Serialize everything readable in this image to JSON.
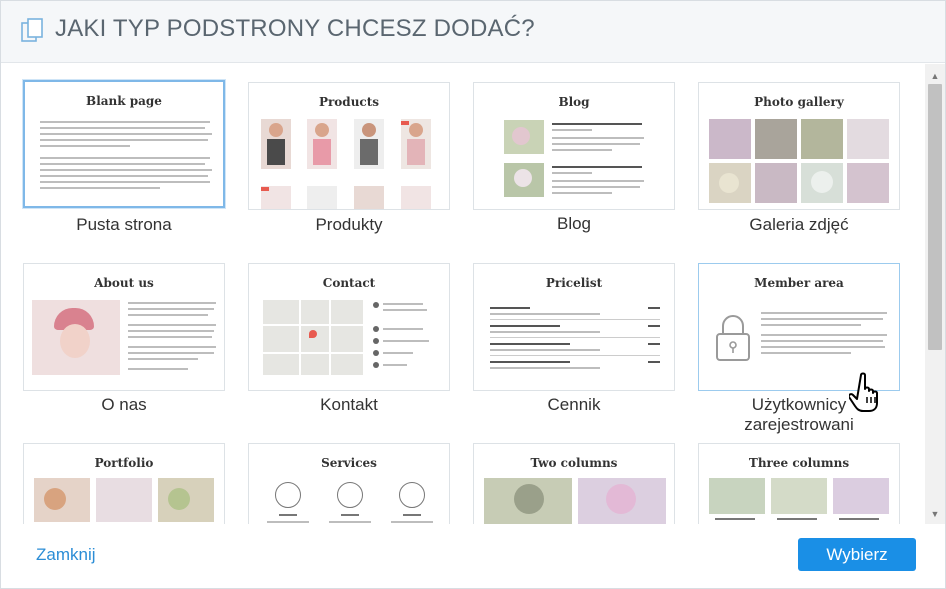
{
  "header": {
    "title": "JAKI TYP PODSTRONY CHCESZ DODAĆ?"
  },
  "cards": [
    {
      "preview_title": "Blank page",
      "label": "Pusta strona"
    },
    {
      "preview_title": "Products",
      "label": "Produkty"
    },
    {
      "preview_title": "Blog",
      "label": "Blog"
    },
    {
      "preview_title": "Photo gallery",
      "label": "Galeria zdjęć"
    },
    {
      "preview_title": "About us",
      "label": "O nas"
    },
    {
      "preview_title": "Contact",
      "label": "Kontakt"
    },
    {
      "preview_title": "Pricelist",
      "label": "Cennik"
    },
    {
      "preview_title": "Member area",
      "label_line1": "Użytkownicy",
      "label_line2": "zarejestrowani"
    },
    {
      "preview_title": "Portfolio"
    },
    {
      "preview_title": "Services"
    },
    {
      "preview_title": "Two columns"
    },
    {
      "preview_title": "Three columns"
    }
  ],
  "footer": {
    "close_label": "Zamknij",
    "select_label": "Wybierz"
  },
  "colors": {
    "accent": "#1a8fe6",
    "link": "#2b8dd6",
    "selected_border": "#7fb8e8"
  },
  "icons": {
    "header": "pages-icon",
    "member": "padlock-icon",
    "cursor": "hand-pointer-icon"
  }
}
